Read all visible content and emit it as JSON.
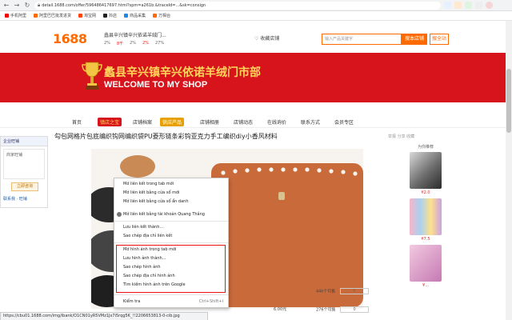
{
  "browser": {
    "url": "detail.1688.com/offer/596486417697.html?spm=a261b.&traceId=...&sk=consign",
    "bookmarks": [
      "手机阿里",
      "阿里巴巴批发进货",
      "淘宝网",
      "抖店",
      "商品采集",
      "万相台"
    ]
  },
  "header": {
    "logo": "1688",
    "shop_name": "蠡县辛兴镇辛兴依诺羊绒门...",
    "stats": [
      "2%",
      "8千",
      "2%",
      "2%",
      "27%"
    ],
    "favorite": "♡ 收藏店铺",
    "search_placeholder": "输入产品关键字",
    "search_btn": "搜本店铺",
    "search_site_btn": "搜全站"
  },
  "banner": {
    "title_cn": "蠡县辛兴镇辛兴依诺羊绒门市部",
    "title_en": "WELCOME TO MY SHOP"
  },
  "shop_nav": {
    "items": [
      "首页",
      "镇店之宝",
      "店铺档案",
      "供应产品",
      "店铺相册",
      "店铺动态",
      "在线询价",
      "联系方式",
      "会员专区"
    ]
  },
  "sidebar": {
    "title": "企业旺铺",
    "hint": "商家旺铺",
    "button": "立即咨询",
    "link": "联系我 · 旺铺"
  },
  "product": {
    "title": "勾包网格片包底编织钩网编织袋PU菱形链条彩钩亚克力手工编织diy小香风材料",
    "actions": "举报  分享  收藏",
    "prices": [
      {
        "qty": "44k个可售",
        "value": "0"
      },
      {
        "qty": "276个可售",
        "value": "0"
      }
    ],
    "price_amount": "6.00元"
  },
  "right_col": {
    "title": "为你推荐",
    "prices": [
      "¥2.0",
      "¥7.5",
      "¥..."
    ]
  },
  "context_menu": {
    "items": [
      "Mở liên kết trong tab mới",
      "Mở liên kết bằng cửa sổ mới",
      "Mở liên kết bằng cửa sổ ẩn danh",
      "Mở liên kết bằng tài khoản Quang Thắng",
      "Lưu liên kết thành...",
      "Sao chép địa chỉ liên kết",
      "Mở hình ảnh trong tab mới",
      "Lưu hình ảnh thành...",
      "Sao chép hình ảnh",
      "Sao chép địa chỉ hình ảnh",
      "Tìm kiếm hình ảnh trên Google",
      "Kiểm tra"
    ],
    "inspect_shortcut": "Ctrl+Shift+I"
  },
  "status_bar": {
    "text": "https://cbu01.1688.com/img/ibank/O1CN01yR5VMz1Jx7i5rqg5K_!!2206653813-0-cib.jpg"
  },
  "colors": {
    "brand_orange": "#ff6a00",
    "banner_red": "#d7131b",
    "leather": "#c96a3a",
    "highlight": "#ee1111"
  }
}
